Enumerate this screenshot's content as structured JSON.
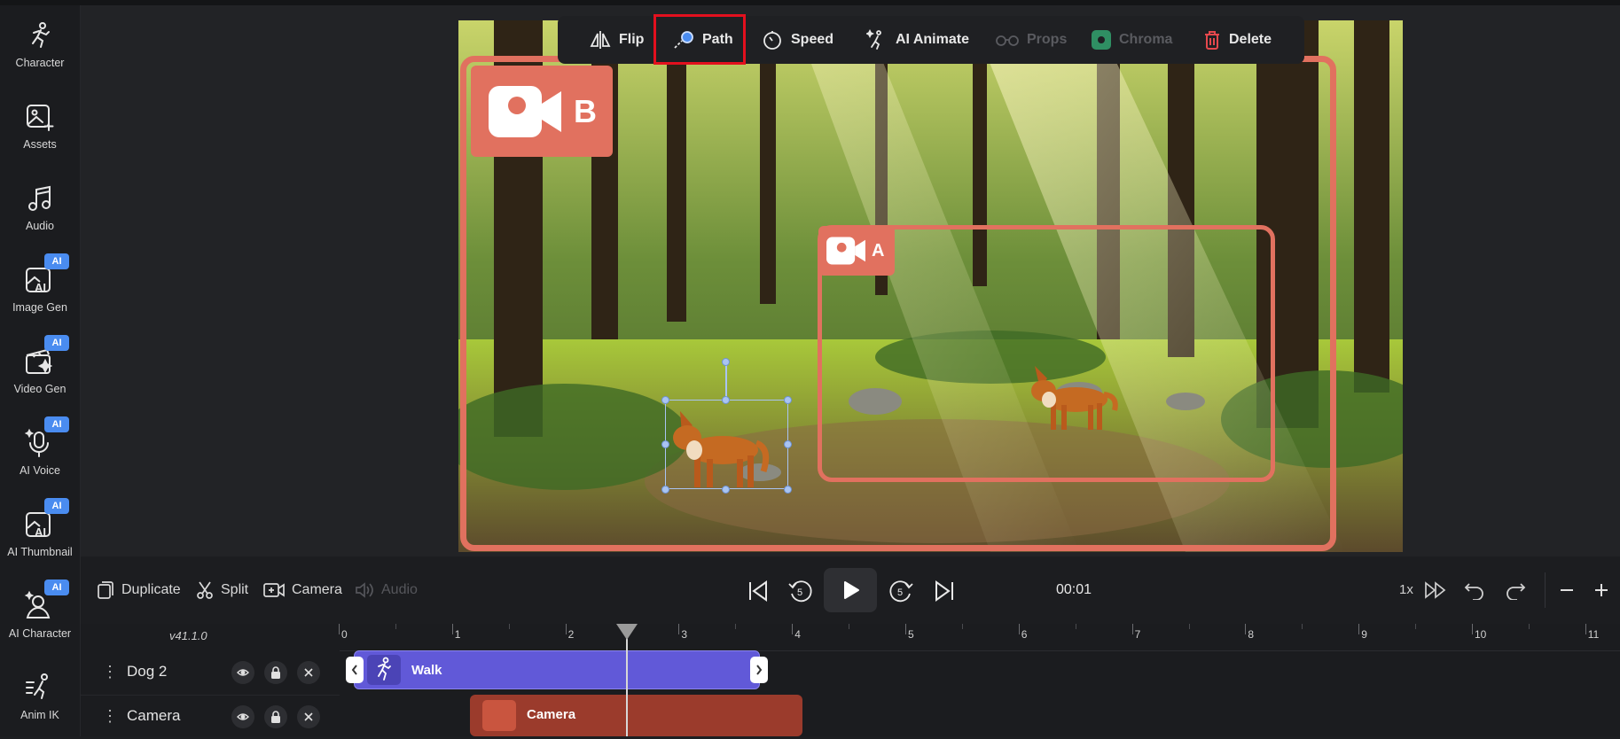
{
  "sidebar": {
    "items": [
      {
        "label": "Character",
        "icon": "character-icon",
        "ai": false
      },
      {
        "label": "Assets",
        "icon": "assets-icon",
        "ai": false
      },
      {
        "label": "Audio",
        "icon": "music-note-icon",
        "ai": false
      },
      {
        "label": "Image Gen",
        "icon": "image-gen-icon",
        "ai": true
      },
      {
        "label": "Video Gen",
        "icon": "video-gen-icon",
        "ai": true
      },
      {
        "label": "AI Voice",
        "icon": "microphone-icon",
        "ai": true
      },
      {
        "label": "AI Thumbnail",
        "icon": "thumbnail-icon",
        "ai": true
      },
      {
        "label": "AI Character",
        "icon": "ai-character-icon",
        "ai": true
      },
      {
        "label": "Anim IK",
        "icon": "anim-ik-icon",
        "ai": false
      }
    ],
    "ai_badge": "AI"
  },
  "toolbar": {
    "flip": "Flip",
    "path": "Path",
    "speed": "Speed",
    "ai_animate": "AI Animate",
    "props": "Props",
    "chroma": "Chroma",
    "delete": "Delete"
  },
  "scene": {
    "camera_b_label": "B",
    "camera_a_label": "A",
    "frame_color": "#e1715f"
  },
  "controls": {
    "duplicate": "Duplicate",
    "split": "Split",
    "camera": "Camera",
    "audio": "Audio",
    "time": "00:01",
    "skip_seconds": "5",
    "speed": "1x"
  },
  "timeline": {
    "version": "v41.1.0",
    "ruler": [
      "0",
      "1",
      "2",
      "3",
      "4",
      "5",
      "6",
      "7",
      "8",
      "9",
      "10",
      "11"
    ],
    "tracks": [
      {
        "name": "Dog 2",
        "clip": "Walk"
      },
      {
        "name": "Camera",
        "clip": "Camera"
      }
    ]
  },
  "colors": {
    "accent_blue": "#4a8cf0",
    "walk_clip": "#6159d8",
    "camera_clip": "#9b3b2c",
    "highlight": "#e3101e"
  }
}
